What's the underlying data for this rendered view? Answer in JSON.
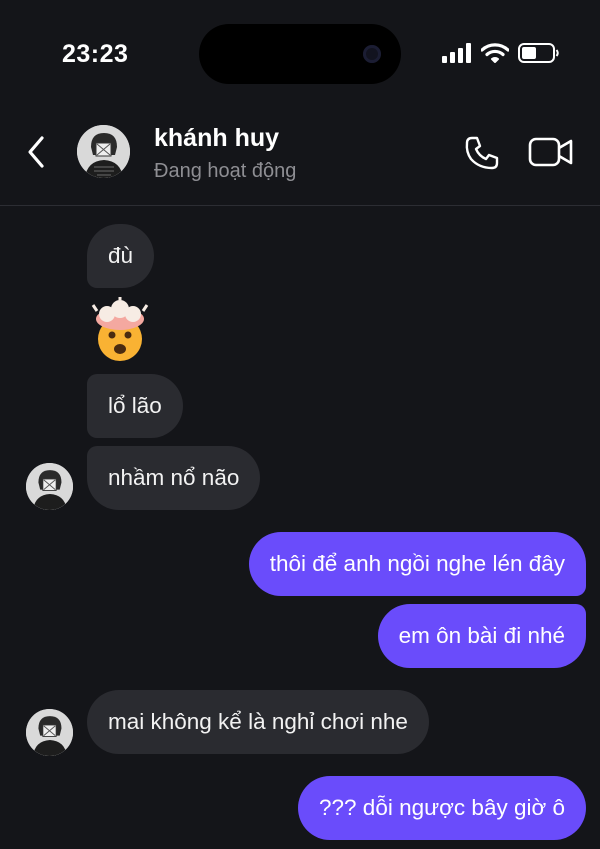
{
  "status_bar": {
    "time": "23:23"
  },
  "header": {
    "contact_name": "khánh huy",
    "presence": "Đang hoạt động"
  },
  "messages": [
    {
      "side": "in",
      "text": "đù"
    },
    {
      "side": "in",
      "emoji": "exploding-head"
    },
    {
      "side": "in",
      "text": "lổ lão"
    },
    {
      "side": "in",
      "text": "nhầm nổ não"
    },
    {
      "side": "out",
      "text": "thôi để anh ngồi nghe lén đây"
    },
    {
      "side": "out",
      "text": "em ôn bài đi nhé"
    },
    {
      "side": "in",
      "text": "mai không kể là nghỉ chơi nhe"
    },
    {
      "side": "out",
      "text": "??? dỗi ngược bây giờ ô"
    }
  ],
  "colors": {
    "background": "#141519",
    "incoming": "#2a2b30",
    "outgoing": "#6a4cfb"
  }
}
